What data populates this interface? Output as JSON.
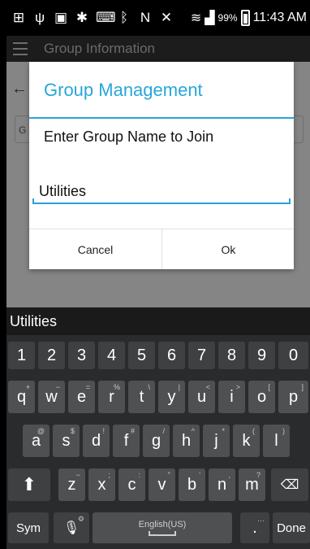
{
  "status_bar": {
    "battery": "99%",
    "time": "11:43 AM",
    "icons": [
      "add-box-icon",
      "usb-icon",
      "image-icon",
      "settings-icon",
      "keyboard-icon",
      "bluetooth-icon",
      "nfc-icon",
      "mute-icon",
      "wifi-icon",
      "signal-icon",
      "battery-icon"
    ]
  },
  "app_bar": {
    "title": "Group Information"
  },
  "background_page": {
    "field_prefix": "G"
  },
  "dialog": {
    "title": "Group Management",
    "message": "Enter Group Name to Join",
    "input_value": "Utilities",
    "cancel_label": "Cancel",
    "ok_label": "Ok",
    "accent_color": "#29a6d9"
  },
  "keyboard": {
    "suggestion": "Utilities",
    "row_numbers": [
      "1",
      "2",
      "3",
      "4",
      "5",
      "6",
      "7",
      "8",
      "9",
      "0"
    ],
    "row1": [
      {
        "k": "q",
        "h": "+"
      },
      {
        "k": "w",
        "h": "−"
      },
      {
        "k": "e",
        "h": "="
      },
      {
        "k": "r",
        "h": "%"
      },
      {
        "k": "t",
        "h": "\\"
      },
      {
        "k": "y",
        "h": "|"
      },
      {
        "k": "u",
        "h": "<"
      },
      {
        "k": "i",
        "h": ">"
      },
      {
        "k": "o",
        "h": "["
      },
      {
        "k": "p",
        "h": "]"
      }
    ],
    "row2": [
      {
        "k": "a",
        "h": "@"
      },
      {
        "k": "s",
        "h": "$"
      },
      {
        "k": "d",
        "h": "!"
      },
      {
        "k": "f",
        "h": "#"
      },
      {
        "k": "g",
        "h": "/"
      },
      {
        "k": "h",
        "h": "^"
      },
      {
        "k": "j",
        "h": "*"
      },
      {
        "k": "k",
        "h": "("
      },
      {
        "k": "l",
        "h": ")"
      }
    ],
    "row3": [
      {
        "k": "z",
        "h": "−"
      },
      {
        "k": "x",
        "h": ";"
      },
      {
        "k": "c",
        "h": ":"
      },
      {
        "k": "v",
        "h": "\""
      },
      {
        "k": "b",
        "h": "'"
      },
      {
        "k": "n",
        "h": ","
      },
      {
        "k": "m",
        "h": "?"
      }
    ],
    "sym_label": "Sym",
    "space_label": "English(US)",
    "period_label": ".",
    "done_label": "Done"
  }
}
